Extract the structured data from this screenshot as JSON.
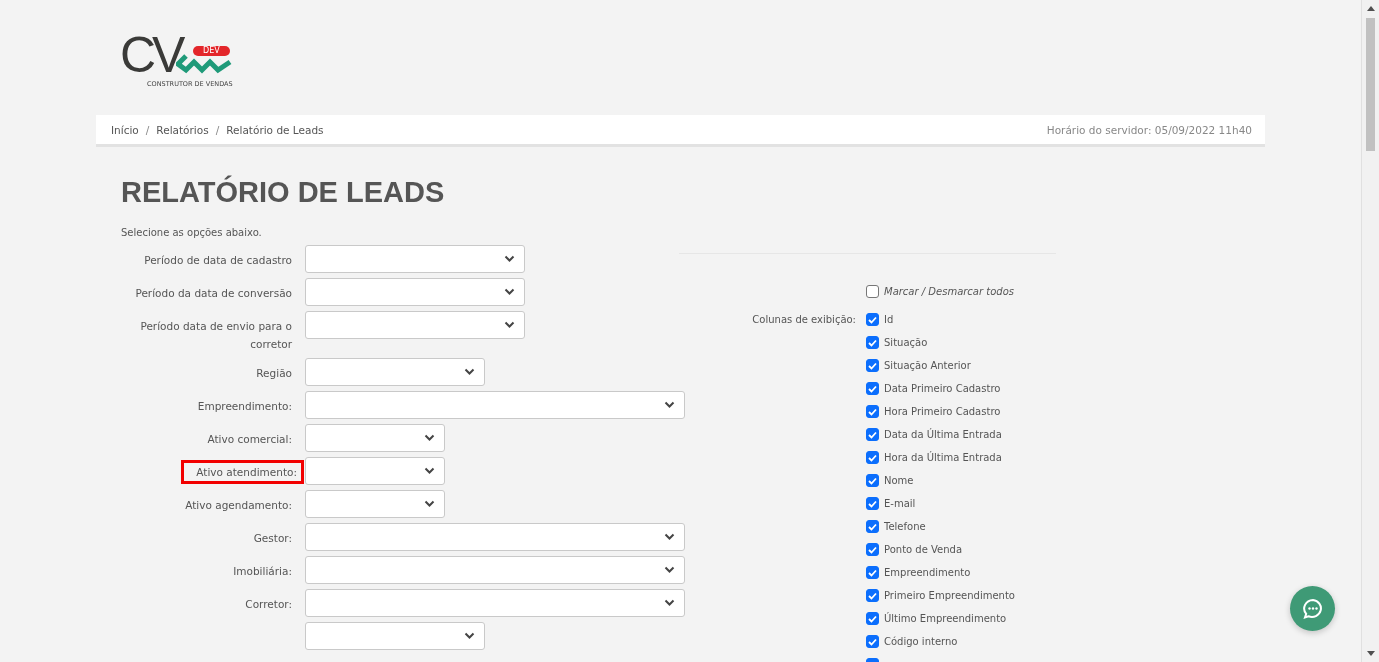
{
  "logo": {
    "mark": "CV",
    "badge": "DEV",
    "tagline": "CONSTRUTOR DE VENDAS"
  },
  "breadcrumb": [
    "Início",
    "Relatórios",
    "Relatório de Leads"
  ],
  "breadcrumb_separator": "/",
  "server_time": "Horário do servidor: 05/09/2022 11h40",
  "title": "RELATÓRIO DE LEADS",
  "intro": "Selecione as opções abaixo.",
  "fields": [
    {
      "label": "Período de data de cadastro",
      "kind": "wide",
      "highlighted": false
    },
    {
      "label": "Período da data de conversão",
      "kind": "wide",
      "highlighted": false
    },
    {
      "label": "Período data de envio para o corretor",
      "kind": "wide",
      "highlighted": false
    },
    {
      "label": "Região",
      "kind": "medium",
      "highlighted": false
    },
    {
      "label": "Empreendimento:",
      "kind": "full",
      "highlighted": false
    },
    {
      "label": "Ativo comercial:",
      "kind": "short",
      "highlighted": false
    },
    {
      "label": "Ativo atendimento:",
      "kind": "short",
      "highlighted": true
    },
    {
      "label": "Ativo agendamento:",
      "kind": "short",
      "highlighted": false
    },
    {
      "label": "Gestor:",
      "kind": "full",
      "highlighted": false
    },
    {
      "label": "Imobiliária:",
      "kind": "full",
      "highlighted": false
    },
    {
      "label": "Corretor:",
      "kind": "full",
      "highlighted": false
    },
    {
      "kind": "medium"
    }
  ],
  "toggle_all": {
    "label": "Marcar / Desmarcar todos",
    "checked": false
  },
  "columns_label": "Colunas de exibição:",
  "columns": [
    {
      "label": "Id",
      "checked": true
    },
    {
      "label": "Situação",
      "checked": true
    },
    {
      "label": "Situação Anterior",
      "checked": true
    },
    {
      "label": "Data Primeiro Cadastro",
      "checked": true
    },
    {
      "label": "Hora Primeiro Cadastro",
      "checked": true
    },
    {
      "label": "Data da Última Entrada",
      "checked": true
    },
    {
      "label": "Hora da Última Entrada",
      "checked": true
    },
    {
      "label": "Nome",
      "checked": true
    },
    {
      "label": "E-mail",
      "checked": true
    },
    {
      "label": "Telefone",
      "checked": true
    },
    {
      "label": "Ponto de Venda",
      "checked": true
    },
    {
      "label": "Empreendimento",
      "checked": true
    },
    {
      "label": "Primeiro Empreendimento",
      "checked": true
    },
    {
      "label": "Último Empreendimento",
      "checked": true
    },
    {
      "label": "Código interno",
      "checked": true
    },
    {
      "checked": true
    }
  ]
}
